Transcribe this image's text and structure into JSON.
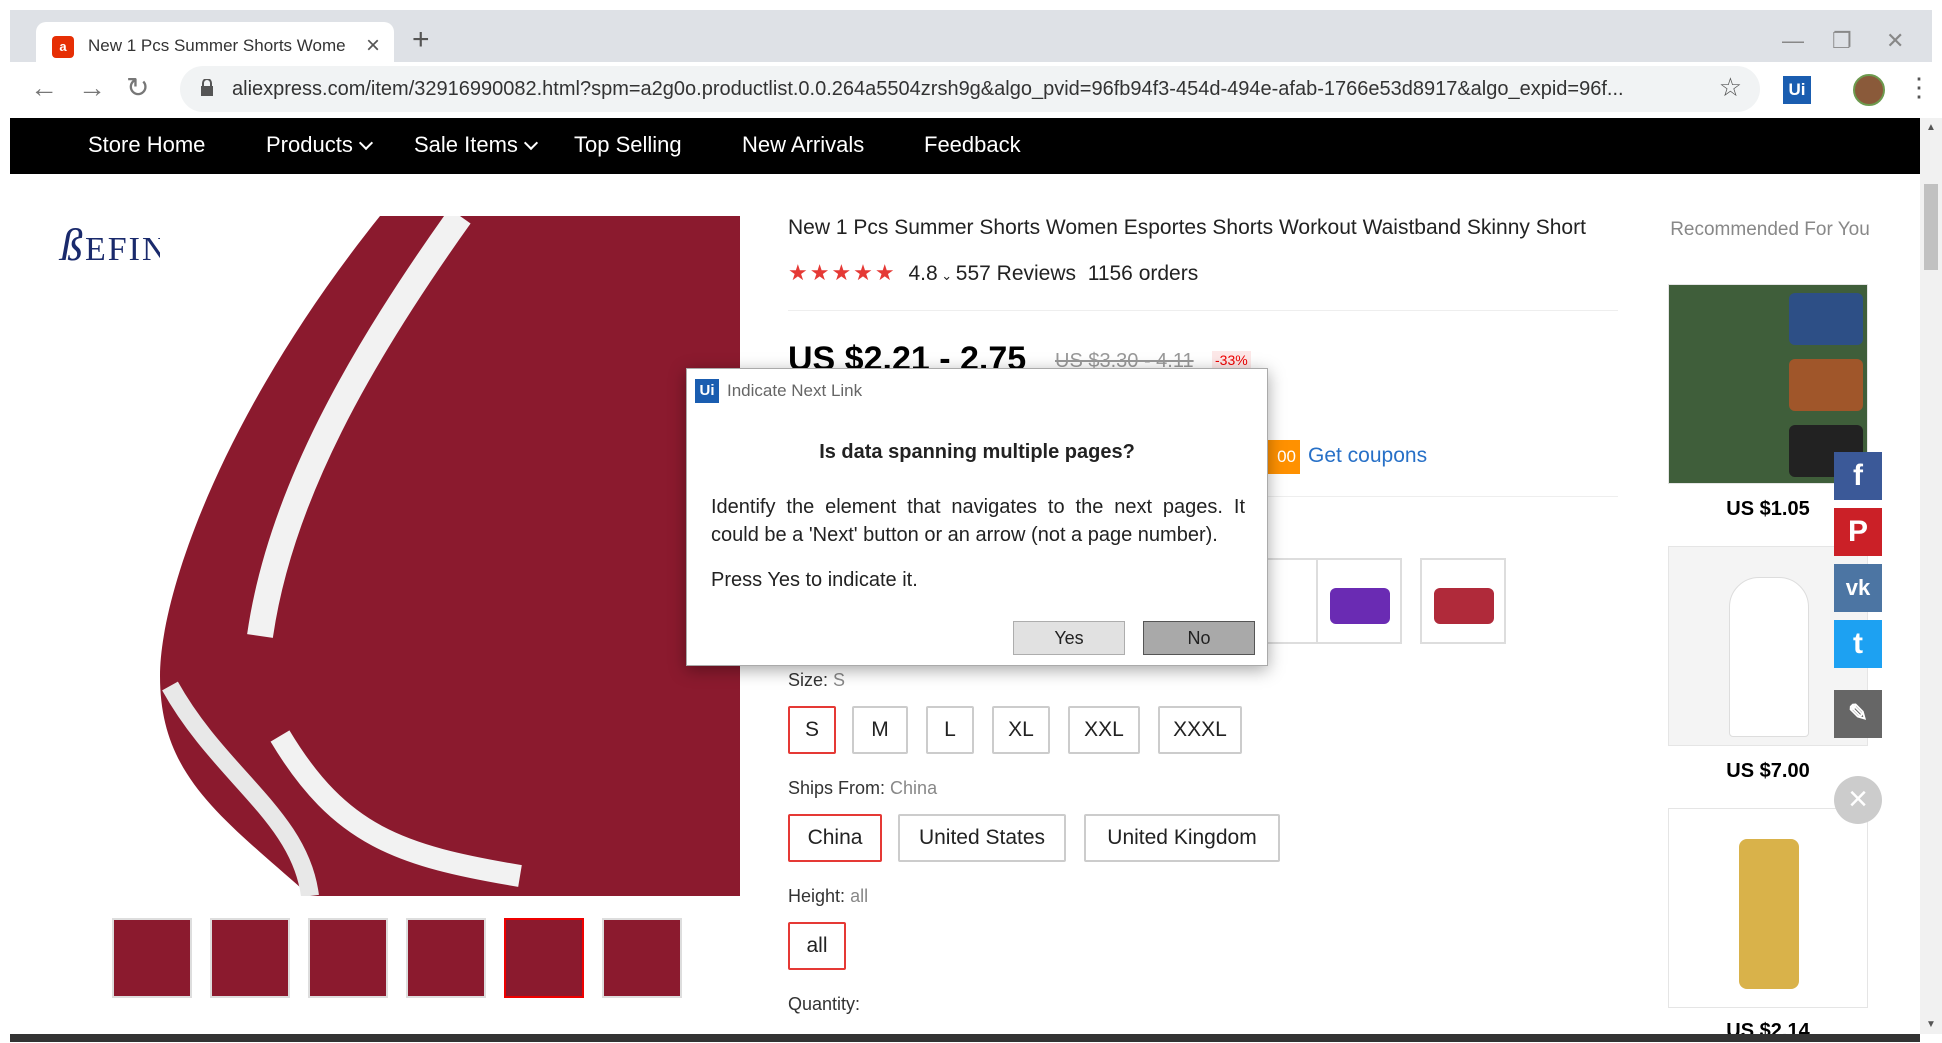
{
  "browser": {
    "tab_title": "New 1 Pcs Summer Shorts Wome",
    "url": "aliexpress.com/item/32916990082.html?spm=a2g0o.productlist.0.0.264a5504zrsh9g&algo_pvid=96fb94f3-454d-494e-afab-1766e53d8917&algo_expid=96f...",
    "ext_label": "Ui"
  },
  "store_nav": {
    "items": [
      "Store Home",
      "Products",
      "Sale Items",
      "Top Selling",
      "New Arrivals",
      "Feedback"
    ]
  },
  "store": {
    "logo_text": "EFINNY"
  },
  "product": {
    "title": "New 1 Pcs Summer Shorts Women Esportes Shorts Workout Waistband Skinny Short",
    "rating": "4.8",
    "reviews": "557 Reviews",
    "orders": "1156 orders",
    "price": "US $2.21 - 2.75",
    "old_price": "US $3.30 - 4.11",
    "discount": "-33%",
    "coupon_tag": "00",
    "get_coupons": "Get coupons",
    "size_label": "Size:",
    "size_value": "S",
    "sizes": [
      "S",
      "M",
      "L",
      "XL",
      "XXL",
      "XXXL"
    ],
    "ships_label": "Ships From:",
    "ships_value": "China",
    "ships": [
      "China",
      "United States",
      "United Kingdom"
    ],
    "height_label": "Height:",
    "height_value": "all",
    "heights": [
      "all"
    ],
    "quantity_label": "Quantity:"
  },
  "recommended": {
    "title": "Recommended For You",
    "prices": [
      "US $1.05",
      "US $7.00",
      "US $2.14"
    ]
  },
  "dialog": {
    "title": "Indicate Next Link",
    "question": "Is data spanning multiple pages?",
    "message": "Identify the element that navigates to the next pages. It could be a 'Next' button or an arrow (not a page number).",
    "press": "Press Yes to indicate it.",
    "yes": "Yes",
    "no": "No"
  },
  "colors": {
    "accent_red": "#e53935",
    "nav_bg": "#000000",
    "link_blue": "#2770c7",
    "product_maroon": "#8b1a2e"
  }
}
